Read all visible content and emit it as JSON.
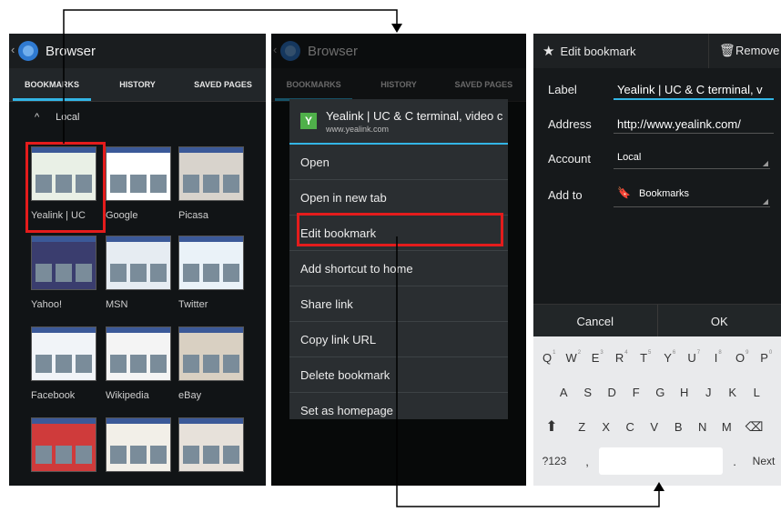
{
  "browser": {
    "title": "Browser",
    "tabs": [
      "BOOKMARKS",
      "HISTORY",
      "SAVED PAGES"
    ],
    "folder": "Local",
    "bookmarks": [
      "Yealink | UC",
      "Google",
      "Picasa",
      "Yahoo!",
      "MSN",
      "Twitter",
      "Facebook",
      "Wikipedia",
      "eBay",
      "",
      "",
      ""
    ]
  },
  "menu": {
    "title": "Yealink | UC & C terminal, video c",
    "url": "www.yealink.com",
    "items": [
      "Open",
      "Open in new tab",
      "Edit bookmark",
      "Add shortcut to home",
      "Share link",
      "Copy link URL",
      "Delete bookmark",
      "Set as homepage"
    ]
  },
  "edit": {
    "title": "Edit bookmark",
    "remove": "Remove",
    "label_caption": "Label",
    "label_value": "Yealink | UC & C terminal, v",
    "address_caption": "Address",
    "address_value": "http://www.yealink.com/",
    "account_caption": "Account",
    "account_value": "Local",
    "addto_caption": "Add to",
    "addto_value": "Bookmarks",
    "cancel": "Cancel",
    "ok": "OK"
  },
  "keyboard": {
    "row1": [
      [
        "Q",
        "1"
      ],
      [
        "W",
        "2"
      ],
      [
        "E",
        "3"
      ],
      [
        "R",
        "4"
      ],
      [
        "T",
        "5"
      ],
      [
        "Y",
        "6"
      ],
      [
        "U",
        "7"
      ],
      [
        "I",
        "8"
      ],
      [
        "O",
        "9"
      ],
      [
        "P",
        "0"
      ]
    ],
    "row2": [
      "A",
      "S",
      "D",
      "F",
      "G",
      "H",
      "J",
      "K",
      "L"
    ],
    "row3": [
      "Z",
      "X",
      "C",
      "V",
      "B",
      "N",
      "M"
    ],
    "sym": "?123",
    "comma": ",",
    "period": ".",
    "next": "Next"
  }
}
